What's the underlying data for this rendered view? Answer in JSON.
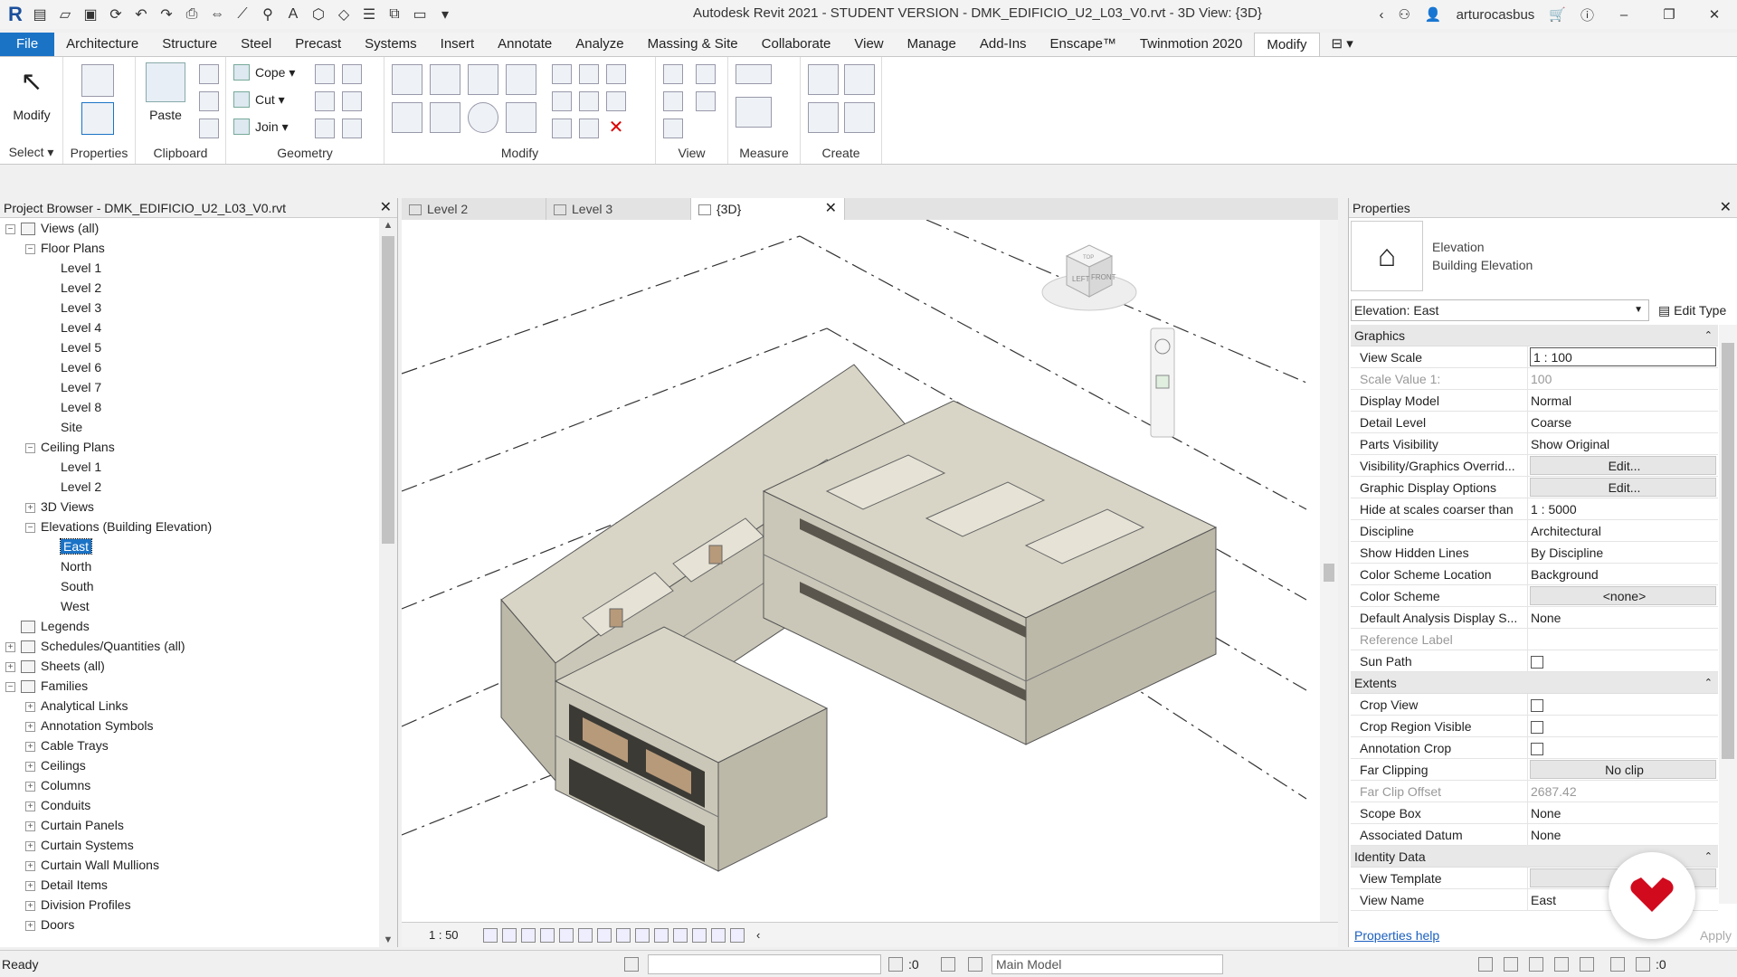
{
  "window": {
    "title": "Autodesk Revit 2021 - STUDENT VERSION - DMK_EDIFICIO_U2_L03_V0.rvt - 3D View: {3D}",
    "user": "arturocasbus"
  },
  "ribbon": {
    "tabs": [
      "File",
      "Architecture",
      "Structure",
      "Steel",
      "Precast",
      "Systems",
      "Insert",
      "Annotate",
      "Analyze",
      "Massing & Site",
      "Collaborate",
      "View",
      "Manage",
      "Add-Ins",
      "Enscape™",
      "Twinmotion 2020",
      "Modify"
    ],
    "active_tab": "Modify",
    "panels": {
      "select": "Select",
      "properties": "Properties",
      "clipboard": "Clipboard",
      "geometry": "Geometry",
      "modify": "Modify",
      "view": "View",
      "measure": "Measure",
      "create": "Create"
    },
    "tools": {
      "modify": "Modify",
      "paste": "Paste",
      "cope": "Cope",
      "cut": "Cut",
      "join": "Join"
    }
  },
  "project_browser": {
    "title": "Project Browser - DMK_EDIFICIO_U2_L03_V0.rvt",
    "nodes": [
      {
        "label": "Views (all)",
        "level": 0,
        "toggle": "−",
        "icon": true
      },
      {
        "label": "Floor Plans",
        "level": 1,
        "toggle": "−"
      },
      {
        "label": "Level 1",
        "level": 2
      },
      {
        "label": "Level 2",
        "level": 2
      },
      {
        "label": "Level 3",
        "level": 2
      },
      {
        "label": "Level 4",
        "level": 2
      },
      {
        "label": "Level 5",
        "level": 2
      },
      {
        "label": "Level 6",
        "level": 2
      },
      {
        "label": "Level 7",
        "level": 2
      },
      {
        "label": "Level 8",
        "level": 2
      },
      {
        "label": "Site",
        "level": 2
      },
      {
        "label": "Ceiling Plans",
        "level": 1,
        "toggle": "−"
      },
      {
        "label": "Level 1",
        "level": 2
      },
      {
        "label": "Level 2",
        "level": 2
      },
      {
        "label": "3D Views",
        "level": 1,
        "toggle": "+"
      },
      {
        "label": "Elevations (Building Elevation)",
        "level": 1,
        "toggle": "−"
      },
      {
        "label": "East",
        "level": 2,
        "selected": true
      },
      {
        "label": "North",
        "level": 2
      },
      {
        "label": "South",
        "level": 2
      },
      {
        "label": "West",
        "level": 2
      },
      {
        "label": "Legends",
        "level": 0,
        "icon": true
      },
      {
        "label": "Schedules/Quantities (all)",
        "level": 0,
        "toggle": "+",
        "icon": true
      },
      {
        "label": "Sheets (all)",
        "level": 0,
        "toggle": "+",
        "icon": true
      },
      {
        "label": "Families",
        "level": 0,
        "toggle": "−",
        "icon": true
      },
      {
        "label": "Analytical Links",
        "level": 1,
        "toggle": "+"
      },
      {
        "label": "Annotation Symbols",
        "level": 1,
        "toggle": "+"
      },
      {
        "label": "Cable Trays",
        "level": 1,
        "toggle": "+"
      },
      {
        "label": "Ceilings",
        "level": 1,
        "toggle": "+"
      },
      {
        "label": "Columns",
        "level": 1,
        "toggle": "+"
      },
      {
        "label": "Conduits",
        "level": 1,
        "toggle": "+"
      },
      {
        "label": "Curtain Panels",
        "level": 1,
        "toggle": "+"
      },
      {
        "label": "Curtain Systems",
        "level": 1,
        "toggle": "+"
      },
      {
        "label": "Curtain Wall Mullions",
        "level": 1,
        "toggle": "+"
      },
      {
        "label": "Detail Items",
        "level": 1,
        "toggle": "+"
      },
      {
        "label": "Division Profiles",
        "level": 1,
        "toggle": "+"
      },
      {
        "label": "Doors",
        "level": 1,
        "toggle": "+"
      }
    ]
  },
  "doc_tabs": [
    {
      "label": "Level 2",
      "active": false
    },
    {
      "label": "Level 3",
      "active": false
    },
    {
      "label": "{3D}",
      "active": true
    }
  ],
  "view_control": {
    "scale": "1 : 50"
  },
  "view_cube": {
    "left": "LEFT",
    "front": "FRONT",
    "top": "TOP"
  },
  "properties": {
    "title": "Properties",
    "type_family": "Elevation",
    "type_name": "Building Elevation",
    "instance_selector": "Elevation: East",
    "edit_type": "Edit Type",
    "groups": [
      {
        "name": "Graphics",
        "rows": [
          {
            "name": "View Scale",
            "value": "1 : 100",
            "style": "boxed"
          },
          {
            "name": "Scale Value    1:",
            "value": "100",
            "style": "dim"
          },
          {
            "name": "Display Model",
            "value": "Normal"
          },
          {
            "name": "Detail Level",
            "value": "Coarse"
          },
          {
            "name": "Parts Visibility",
            "value": "Show Original"
          },
          {
            "name": "Visibility/Graphics Overrid...",
            "value": "Edit...",
            "style": "btn"
          },
          {
            "name": "Graphic Display Options",
            "value": "Edit...",
            "style": "btn"
          },
          {
            "name": "Hide at scales coarser than",
            "value": "1 : 5000"
          },
          {
            "name": "Discipline",
            "value": "Architectural"
          },
          {
            "name": "Show Hidden Lines",
            "value": "By Discipline"
          },
          {
            "name": "Color Scheme Location",
            "value": "Background"
          },
          {
            "name": "Color Scheme",
            "value": "<none>",
            "style": "btn"
          },
          {
            "name": "Default Analysis Display S...",
            "value": "None"
          },
          {
            "name": "Reference Label",
            "value": "",
            "style": "dimname"
          },
          {
            "name": "Sun Path",
            "value": "",
            "style": "check"
          }
        ]
      },
      {
        "name": "Extents",
        "rows": [
          {
            "name": "Crop View",
            "value": "",
            "style": "check"
          },
          {
            "name": "Crop Region Visible",
            "value": "",
            "style": "check"
          },
          {
            "name": "Annotation Crop",
            "value": "",
            "style": "check"
          },
          {
            "name": "Far Clipping",
            "value": "No clip",
            "style": "btn"
          },
          {
            "name": "Far Clip Offset",
            "value": "2687.42",
            "style": "dimboth"
          },
          {
            "name": "Scope Box",
            "value": "None"
          },
          {
            "name": "Associated Datum",
            "value": "None"
          }
        ]
      },
      {
        "name": "Identity Data",
        "rows": [
          {
            "name": "View Template",
            "value": "<N",
            "style": "btn"
          },
          {
            "name": "View Name",
            "value": "East"
          }
        ]
      }
    ],
    "help_link": "Properties help",
    "apply": "Apply"
  },
  "status_bar": {
    "text": "Ready",
    "workset_count": ":0",
    "model": "Main Model",
    "filter_count": ":0"
  },
  "colors": {
    "accent": "#1b73c6",
    "badge_heart": "#d10a1e",
    "wall": "#c9c6b8",
    "wall_dark": "#8e8b80",
    "floor": "#b79a7a"
  }
}
